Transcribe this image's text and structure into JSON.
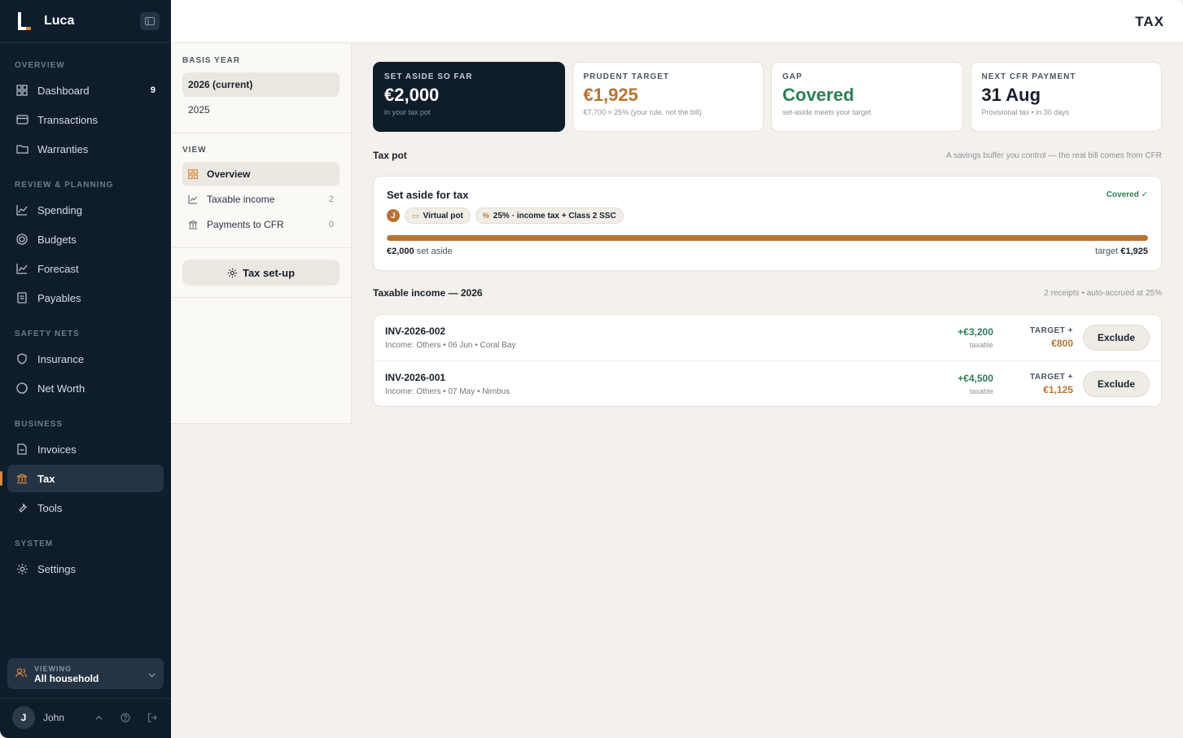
{
  "app": {
    "name": "Luca",
    "page_title": "TAX"
  },
  "sidebar": {
    "sections": [
      {
        "label": "OVERVIEW",
        "items": [
          {
            "label": "Dashboard",
            "icon": "dashboard-icon",
            "count": "9"
          },
          {
            "label": "Transactions",
            "icon": "card-icon"
          },
          {
            "label": "Warranties",
            "icon": "folder-icon"
          }
        ]
      },
      {
        "label": "REVIEW & PLANNING",
        "items": [
          {
            "label": "Spending",
            "icon": "chart-icon"
          },
          {
            "label": "Budgets",
            "icon": "target-icon"
          },
          {
            "label": "Forecast",
            "icon": "chart-icon"
          },
          {
            "label": "Payables",
            "icon": "document-icon"
          }
        ]
      },
      {
        "label": "SAFETY NETS",
        "items": [
          {
            "label": "Insurance",
            "icon": "shield-icon"
          },
          {
            "label": "Net Worth",
            "icon": "networth-icon"
          }
        ]
      },
      {
        "label": "BUSINESS",
        "items": [
          {
            "label": "Invoices",
            "icon": "invoice-icon"
          },
          {
            "label": "Tax",
            "icon": "bank-icon",
            "active": true
          },
          {
            "label": "Tools",
            "icon": "wrench-icon"
          }
        ]
      },
      {
        "label": "SYSTEM",
        "items": [
          {
            "label": "Settings",
            "icon": "gear-icon"
          }
        ]
      }
    ],
    "viewing": {
      "label": "VIEWING",
      "value": "All household"
    },
    "user": {
      "initial": "J",
      "name": "John"
    }
  },
  "subpanel": {
    "basis_year": {
      "heading": "BASIS YEAR",
      "options": [
        "2026 (current)",
        "2025"
      ]
    },
    "view": {
      "heading": "VIEW",
      "items": [
        {
          "label": "Overview",
          "count": ""
        },
        {
          "label": "Taxable income",
          "count": "2"
        },
        {
          "label": "Payments to CFR",
          "count": "0"
        }
      ]
    },
    "setup_label": "Tax set-up"
  },
  "stats": [
    {
      "label": "SET ASIDE SO FAR",
      "value": "€2,000",
      "sub": "in your tax pot"
    },
    {
      "label": "PRUDENT TARGET",
      "value": "€1,925",
      "sub": "€7,700 × 25% (your rule, not the bill)"
    },
    {
      "label": "GAP",
      "value": "Covered",
      "sub": "set-aside meets your target"
    },
    {
      "label": "NEXT CFR PAYMENT",
      "value": "31 Aug",
      "sub": "Provisional tax • in 30 days"
    }
  ],
  "tax_pot": {
    "heading": "Tax pot",
    "note": "A savings buffer you control — the real bill comes from CFR",
    "card_title": "Set aside for tax",
    "status": "Covered ✓",
    "avatar": "J",
    "chip_pot": "Virtual pot",
    "chip_rule": "25% · income tax + Class 2 SSC",
    "progress": 1.0,
    "set_aside_value": "€2,000",
    "set_aside_label": "set aside",
    "target_label": "target",
    "target_value": "€1,925"
  },
  "taxable_income": {
    "heading": "Taxable income — 2026",
    "note": "2 receipts • auto-accrued at 25%",
    "rows": [
      {
        "id": "INV-2026-002",
        "meta": "Income: Others • 06 Jun • Coral Bay",
        "amount": "+€3,200",
        "amount_label": "taxable",
        "target_label": "TARGET +",
        "target": "€800",
        "action": "Exclude"
      },
      {
        "id": "INV-2026-001",
        "meta": "Income: Others • 07 May • Nimbus",
        "amount": "+€4,500",
        "amount_label": "taxable",
        "target_label": "TARGET +",
        "target": "€1,125",
        "action": "Exclude"
      }
    ]
  },
  "colors": {
    "accent": "#b87333",
    "positive": "#2f7d55",
    "sidebar_bg": "#0f1c2b"
  }
}
